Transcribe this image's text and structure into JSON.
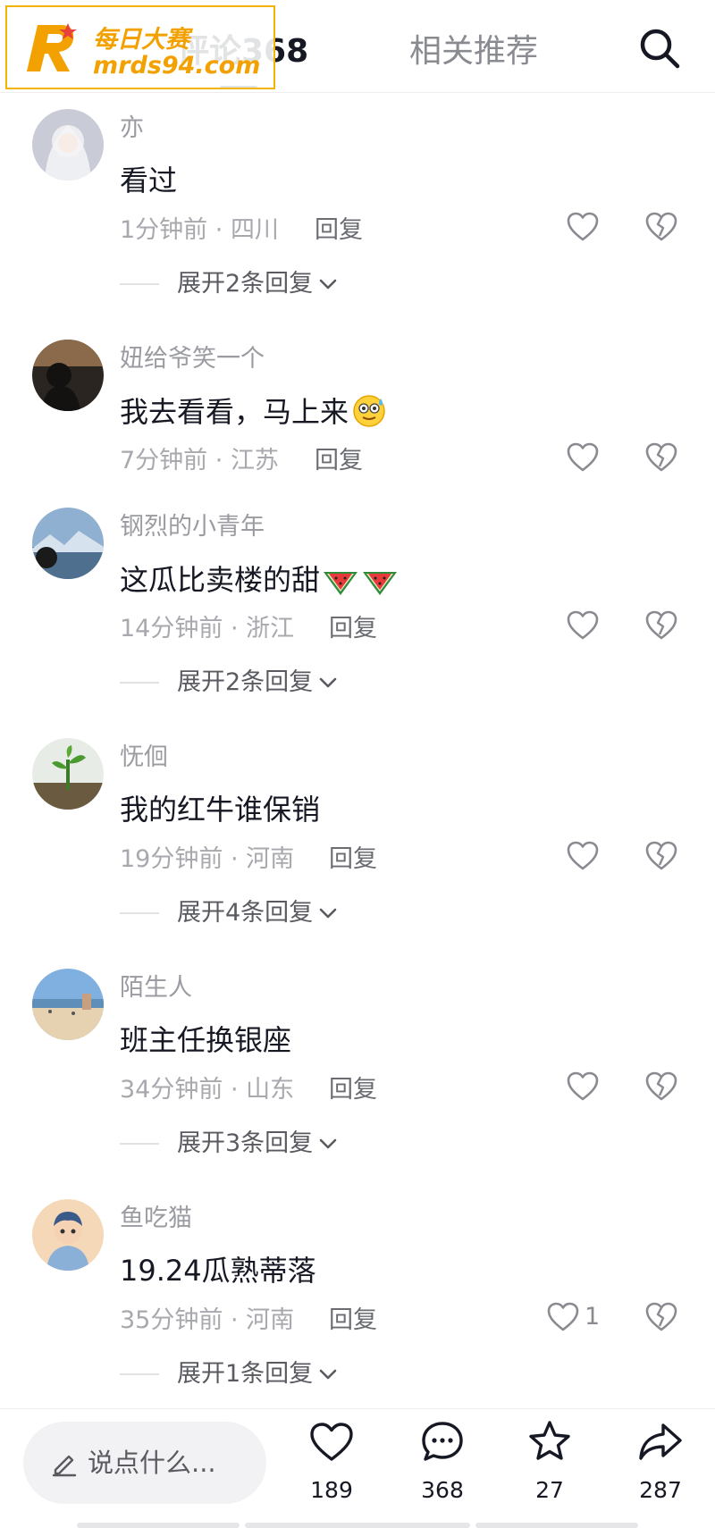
{
  "watermark": {
    "line1": "每日大赛",
    "line2": "mrds94.com"
  },
  "header": {
    "tabs": [
      {
        "label": "评论368",
        "active": true
      },
      {
        "label": "相关推荐",
        "active": false
      }
    ],
    "search_icon": "search-icon"
  },
  "comments": [
    {
      "username": "亦",
      "text": "看过",
      "time": "1分钟前",
      "location": "四川",
      "reply_label": "回复",
      "like_count": "",
      "expand_label": "展开2条回复",
      "emoji": []
    },
    {
      "username": "妞给爷笑一个",
      "text": "我去看看，马上来",
      "time": "7分钟前",
      "location": "江苏",
      "reply_label": "回复",
      "like_count": "",
      "expand_label": "",
      "emoji": [
        "sweat-smile-emoji"
      ]
    },
    {
      "username": "钢烈的小青年",
      "text": "这瓜比卖楼的甜",
      "time": "14分钟前",
      "location": "浙江",
      "reply_label": "回复",
      "like_count": "",
      "expand_label": "展开2条回复",
      "emoji": [
        "watermelon-emoji",
        "watermelon-emoji"
      ]
    },
    {
      "username": "怃佪",
      "text": "我的红牛谁保销",
      "time": "19分钟前",
      "location": "河南",
      "reply_label": "回复",
      "like_count": "",
      "expand_label": "展开4条回复",
      "emoji": []
    },
    {
      "username": "陌生人",
      "text": "班主任换银座",
      "time": "34分钟前",
      "location": "山东",
      "reply_label": "回复",
      "like_count": "",
      "expand_label": "展开3条回复",
      "emoji": []
    },
    {
      "username": "鱼吃猫",
      "text": "19.24瓜熟蒂落",
      "time": "35分钟前",
      "location": "河南",
      "reply_label": "回复",
      "like_count": "1",
      "expand_label": "展开1条回复",
      "emoji": []
    }
  ],
  "bottom_bar": {
    "input_placeholder": "说点什么...",
    "actions": [
      {
        "icon": "heart-icon",
        "count": "189"
      },
      {
        "icon": "comment-icon",
        "count": "368"
      },
      {
        "icon": "star-icon",
        "count": "27"
      },
      {
        "icon": "share-icon",
        "count": "287"
      }
    ]
  },
  "colors": {
    "text": "#161823",
    "secondary": "#9b9ca2",
    "watermark": "#f2a100"
  }
}
